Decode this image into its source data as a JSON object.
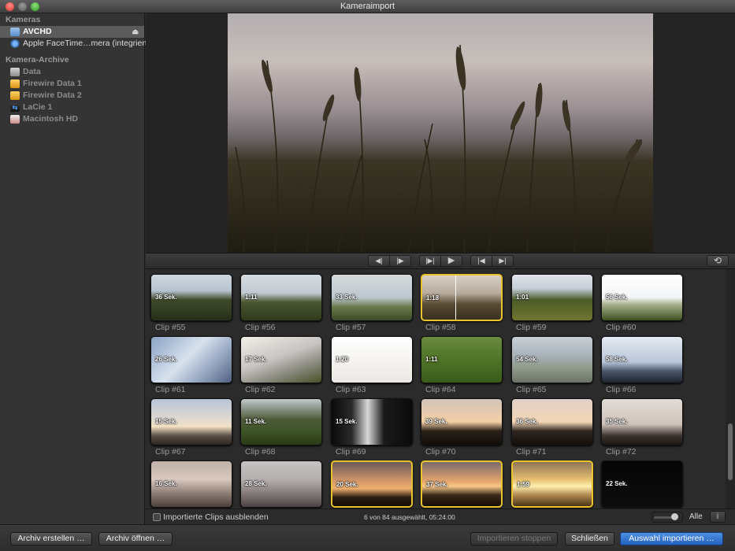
{
  "window": {
    "title": "Kameraimport"
  },
  "sidebar": {
    "sections": [
      {
        "label": "Kameras",
        "items": [
          {
            "label": "AVCHD",
            "icon": "folder-icon",
            "selected": true,
            "eject": true
          },
          {
            "label": "Apple FaceTime…mera (integriert)",
            "icon": "camera-icon"
          }
        ]
      },
      {
        "label": "Kamera-Archive",
        "items": [
          {
            "label": "Data",
            "icon": "drive-icon"
          },
          {
            "label": "Firewire Data 1",
            "icon": "firewire-drive-icon"
          },
          {
            "label": "Firewire Data 2",
            "icon": "firewire-drive-icon"
          },
          {
            "label": "LaCie 1",
            "icon": "usb-drive-icon"
          },
          {
            "label": "Macintosh HD",
            "icon": "home-icon"
          }
        ]
      }
    ]
  },
  "controls": {
    "prev_frame": "◀|",
    "next_frame": "|▶",
    "to_start_play": "|▶|",
    "play": "▶",
    "go_start": "|◀",
    "go_end": "▶|",
    "loop": "⟲"
  },
  "clips": [
    {
      "name": "Clip #55",
      "duration": "36 Sek.",
      "scene": "trees",
      "selected": false
    },
    {
      "name": "Clip #56",
      "duration": "1:11",
      "scene": "trees2",
      "selected": false
    },
    {
      "name": "Clip #57",
      "duration": "33 Sek.",
      "scene": "hills",
      "selected": false
    },
    {
      "name": "Clip #58",
      "duration": "1:18",
      "scene": "grass",
      "selected": true
    },
    {
      "name": "Clip #59",
      "duration": "1:01",
      "scene": "field",
      "selected": false
    },
    {
      "name": "Clip #60",
      "duration": "56 Sek.",
      "scene": "bright",
      "selected": false
    },
    {
      "name": "Clip #61",
      "duration": "26 Sek.",
      "scene": "clouds",
      "selected": false
    },
    {
      "name": "Clip #62",
      "duration": "17 Sek.",
      "scene": "clouds2",
      "selected": false
    },
    {
      "name": "Clip #63",
      "duration": "1:20",
      "scene": "white",
      "selected": false
    },
    {
      "name": "Clip #64",
      "duration": "1:11",
      "scene": "lawn",
      "selected": false
    },
    {
      "name": "Clip #65",
      "duration": "54 Sek.",
      "scene": "meadow",
      "selected": false
    },
    {
      "name": "Clip #66",
      "duration": "58 Sek.",
      "scene": "horizon",
      "selected": false
    },
    {
      "name": "Clip #67",
      "duration": "15 Sek.",
      "scene": "sunset1",
      "selected": false
    },
    {
      "name": "Clip #68",
      "duration": "11 Sek.",
      "scene": "greenfield",
      "selected": false
    },
    {
      "name": "Clip #69",
      "duration": "15 Sek.",
      "scene": "dark",
      "selected": false
    },
    {
      "name": "Clip #70",
      "duration": "39 Sek.",
      "scene": "trees-sunset",
      "selected": false
    },
    {
      "name": "Clip #71",
      "duration": "36 Sek.",
      "scene": "trees-sunset2",
      "selected": false
    },
    {
      "name": "Clip #72",
      "duration": "35 Sek.",
      "scene": "dusk",
      "selected": false
    },
    {
      "name": "",
      "duration": "16 Sek.",
      "scene": "dusk2",
      "selected": false
    },
    {
      "name": "",
      "duration": "28 Sek.",
      "scene": "dusk3",
      "selected": false
    },
    {
      "name": "",
      "duration": "20 Sek.",
      "scene": "sunset-orange",
      "selected": true
    },
    {
      "name": "",
      "duration": "37 Sek.",
      "scene": "sunset-orange2",
      "selected": true
    },
    {
      "name": "",
      "duration": "1:59",
      "scene": "sunset-yellow",
      "selected": true
    },
    {
      "name": "",
      "duration": "22 Sek.",
      "scene": "night",
      "selected": false
    }
  ],
  "statusbar": {
    "hide_imported_label": "Importierte Clips ausblenden",
    "status": "6 von 84 ausgewählt, 05:24:00",
    "zoom_label": "Alle",
    "info_icon": "i"
  },
  "footer": {
    "create_archive": "Archiv erstellen …",
    "open_archive": "Archiv öffnen …",
    "stop_import": "Importieren stoppen",
    "close": "Schließen",
    "import_selection": "Auswahl importieren …"
  },
  "colors": {
    "selection": "#e8c32c",
    "primary_button": "#2f73d0"
  }
}
